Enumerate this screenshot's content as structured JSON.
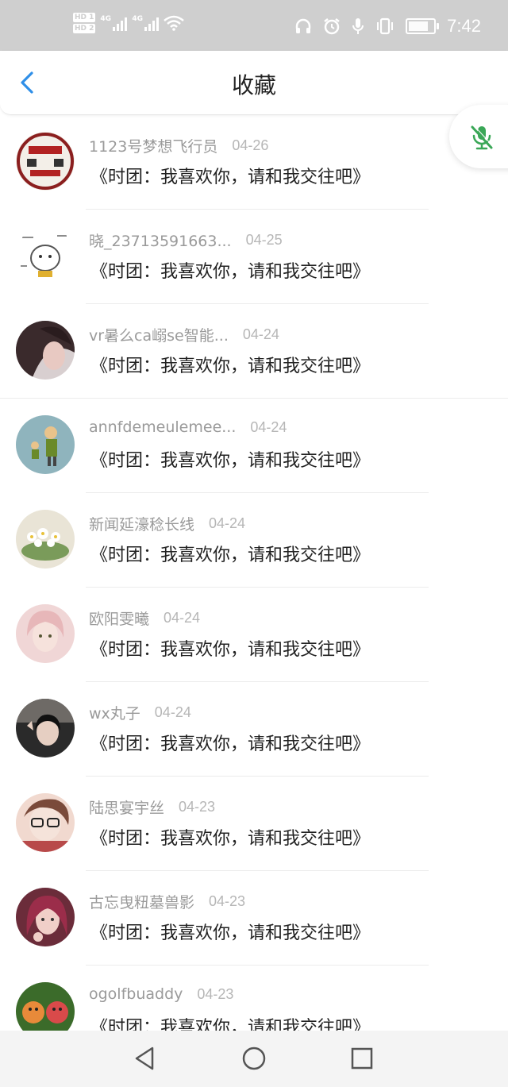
{
  "status_bar": {
    "time": "7:42",
    "sim1_label": "HD 1",
    "sim2_label": "HD 2",
    "network1": "4G",
    "network2": "4G",
    "icons": [
      "signal-icon",
      "wifi-icon",
      "headphones-icon",
      "alarm-icon",
      "mic-icon",
      "vibrate-icon",
      "battery-icon"
    ]
  },
  "header": {
    "title": "收藏",
    "back_icon": "chevron-left-icon",
    "accent_color": "#2f8fe8"
  },
  "mic_button": {
    "icon": "mic-off-icon",
    "color": "#3aa757"
  },
  "favorites": [
    {
      "name": "1123号梦想飞行员",
      "date": "04-26",
      "title": "《时团：我喜欢你，请和我交往吧》"
    },
    {
      "name": "晓_23713591663...",
      "date": "04-25",
      "title": "《时团：我喜欢你，请和我交往吧》"
    },
    {
      "name": "vr暑么ca嵶se智能...",
      "date": "04-24",
      "title": "《时团：我喜欢你，请和我交往吧》"
    },
    {
      "name": "annfdemeulemee...",
      "date": "04-24",
      "title": "《时团：我喜欢你，请和我交往吧》"
    },
    {
      "name": "新闻延濠稔长线",
      "date": "04-24",
      "title": "《时团：我喜欢你，请和我交往吧》"
    },
    {
      "name": "欧阳雯曦",
      "date": "04-24",
      "title": "《时团：我喜欢你，请和我交往吧》"
    },
    {
      "name": "wx丸子",
      "date": "04-24",
      "title": "《时团：我喜欢你，请和我交往吧》"
    },
    {
      "name": "陆思宴宇丝",
      "date": "04-23",
      "title": "《时团：我喜欢你，请和我交往吧》"
    },
    {
      "name": "古忘曳粈墓兽影",
      "date": "04-23",
      "title": "《时团：我喜欢你，请和我交往吧》"
    },
    {
      "name": "ogolfbuaddy",
      "date": "04-23",
      "title": "《时团：我喜欢你，请和我交往吧》"
    }
  ],
  "system_nav": {
    "icons": [
      "back-triangle-icon",
      "home-circle-icon",
      "recents-square-icon"
    ]
  }
}
